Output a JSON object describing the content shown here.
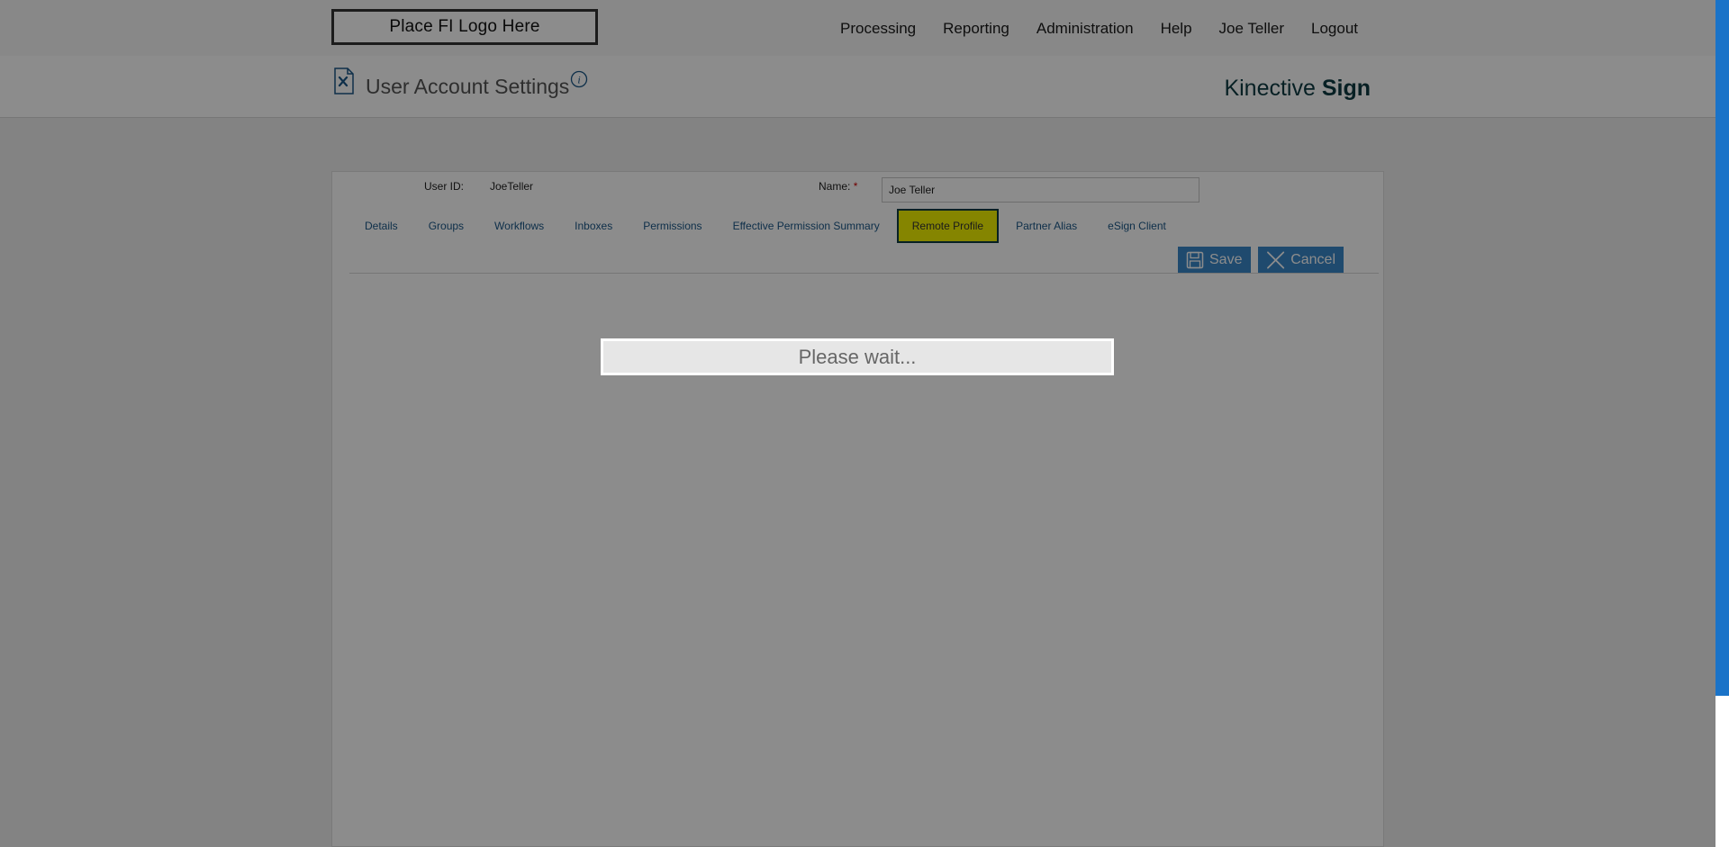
{
  "header": {
    "logo_text": "Place FI Logo Here",
    "nav": [
      "Processing",
      "Reporting",
      "Administration",
      "Help",
      "Joe Teller",
      "Logout"
    ]
  },
  "subheader": {
    "title": "User Account Settings",
    "brand_light": "Kinective ",
    "brand_bold": "Sign"
  },
  "form": {
    "user_id_label": "User ID:",
    "user_id_value": "JoeTeller",
    "name_label": "Name:",
    "name_required": "*",
    "name_value": "Joe Teller"
  },
  "tabs": [
    {
      "label": "Details",
      "active": false
    },
    {
      "label": "Groups",
      "active": false
    },
    {
      "label": "Workflows",
      "active": false
    },
    {
      "label": "Inboxes",
      "active": false
    },
    {
      "label": "Permissions",
      "active": false
    },
    {
      "label": "Effective Permission Summary",
      "active": false
    },
    {
      "label": "Remote Profile",
      "active": true
    },
    {
      "label": "Partner Alias",
      "active": false
    },
    {
      "label": "eSign Client",
      "active": false
    }
  ],
  "actions": {
    "save_label": "Save",
    "cancel_label": "Cancel"
  },
  "modal": {
    "wait_text": "Please wait..."
  },
  "colors": {
    "accent": "#3a87c8",
    "active_tab": "#f2f200",
    "brand": "#0e3b43"
  }
}
